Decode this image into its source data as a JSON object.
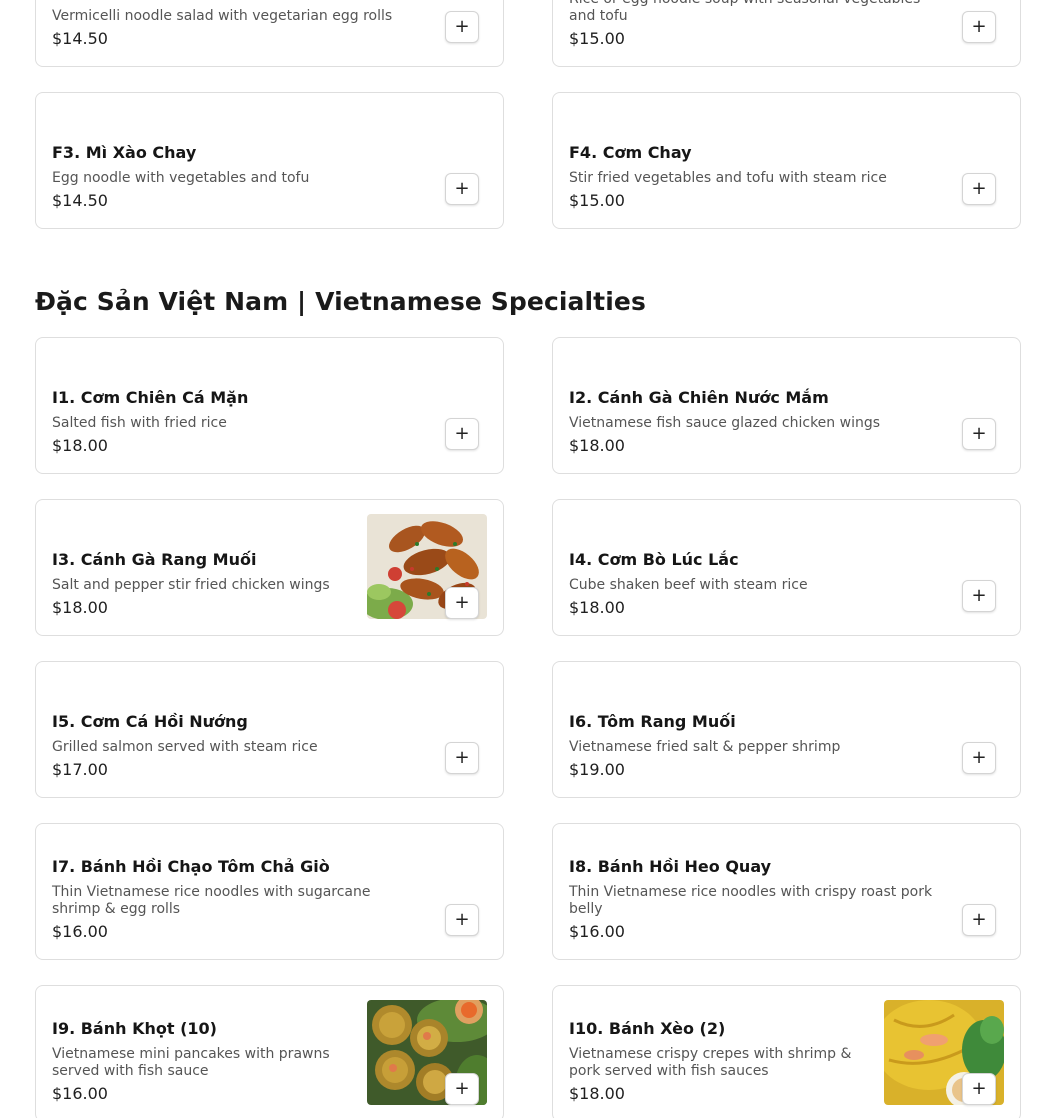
{
  "top_items": [
    {
      "name": "",
      "desc": "Vermicelli noodle salad with vegetarian egg rolls",
      "price": "$14.50",
      "add": "+"
    },
    {
      "name": "",
      "desc": "Rice or egg noodle soup with seasonal vegetables and tofu",
      "price": "$15.00",
      "add": "+"
    },
    {
      "name": "F3. Mì Xào Chay",
      "desc": "Egg noodle with vegetables and tofu",
      "price": "$14.50",
      "add": "+"
    },
    {
      "name": "F4. Cơm Chay",
      "desc": "Stir fried vegetables and tofu with steam rice",
      "price": "$15.00",
      "add": "+"
    }
  ],
  "specialties": {
    "title": "Đặc Sản Việt Nam | Vietnamese Specialties",
    "items": [
      {
        "name": "I1. Cơm Chiên Cá Mặn",
        "desc": "Salted fish with fried rice",
        "price": "$18.00",
        "add": "+"
      },
      {
        "name": "I2. Cánh Gà Chiên Nước Mắm",
        "desc": "Vietnamese fish sauce glazed chicken wings",
        "price": "$18.00",
        "add": "+"
      },
      {
        "name": "I3. Cánh Gà Rang Muối",
        "desc": "Salt and pepper stir fried chicken wings",
        "price": "$18.00",
        "add": "+"
      },
      {
        "name": "I4. Cơm Bò Lúc Lắc",
        "desc": "Cube shaken beef with steam rice",
        "price": "$18.00",
        "add": "+"
      },
      {
        "name": "I5. Cơm Cá Hồi Nướng",
        "desc": "Grilled salmon served with steam rice",
        "price": "$17.00",
        "add": "+"
      },
      {
        "name": "I6. Tôm Rang Muối",
        "desc": "Vietnamese fried salt & pepper shrimp",
        "price": "$19.00",
        "add": "+"
      },
      {
        "name": "I7. Bánh Hồi Chạo Tôm Chả Giò",
        "desc": "Thin Vietnamese rice noodles with sugarcane shrimp & egg rolls",
        "price": "$16.00",
        "add": "+"
      },
      {
        "name": "I8. Bánh Hồi Heo Quay",
        "desc": "Thin Vietnamese rice noodles with crispy roast pork belly",
        "price": "$16.00",
        "add": "+"
      },
      {
        "name": "I9. Bánh Khọt (10)",
        "desc": "Vietnamese mini pancakes with prawns served with fish sauce",
        "price": "$16.00",
        "add": "+"
      },
      {
        "name": "I10. Bánh Xèo (2)",
        "desc": "Vietnamese crispy crepes with shrimp & pork served with fish sauces",
        "price": "$18.00",
        "add": "+"
      }
    ]
  },
  "colors": {
    "border": "#dedede",
    "text": "#1a1a1a",
    "muted": "#555555",
    "background": "#ffffff"
  }
}
